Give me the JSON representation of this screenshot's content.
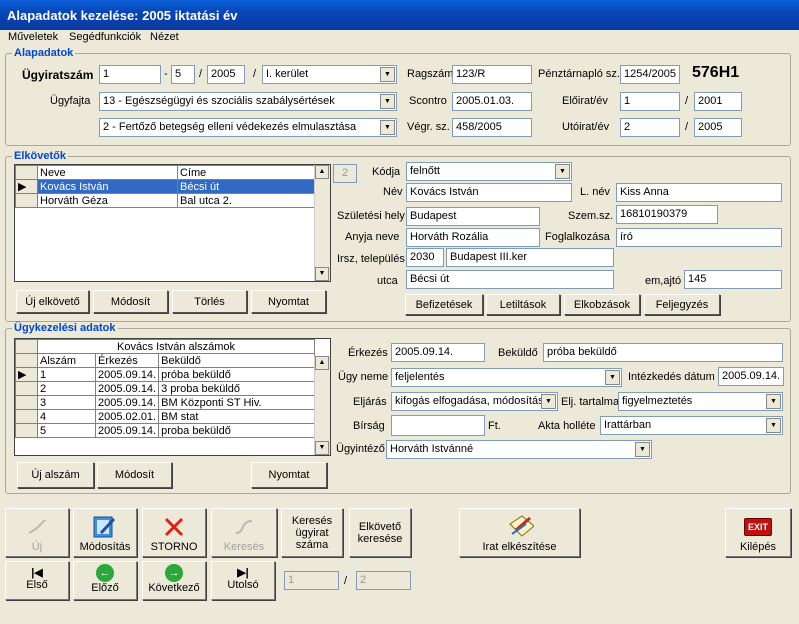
{
  "window": {
    "title": "Alapadatok kezelése:  2005 iktatási év"
  },
  "menu": [
    "Műveletek",
    "Segédfunkciók",
    "Nézet"
  ],
  "alap": {
    "group_title": "Alapadatok",
    "ugyiratszam_label": "Ügyiratszám",
    "ugyiratszam_1": "1",
    "ugyiratszam_dash": "-",
    "ugyiratszam_2": "5",
    "slash1": "/",
    "ugyiratszam_3": "2005",
    "slash2": "/",
    "kerulet": "I. kerület",
    "ragszam_label": "Ragszám",
    "ragszam": "123/R",
    "penztar_label": "Pénztárnapló sz.",
    "penztar": "1254/2005",
    "code": "576H1",
    "ugyfajta_label": "Ügyfajta",
    "ugyfajta1": "13 - Egészségügyi és szociális szabálysértések",
    "ugyfajta2": "2 - Fertőző betegség elleni védekezés elmulasztása",
    "scontro_label": "Scontro",
    "scontro": "2005.01.03.",
    "eloirat_label": "Előirat/év",
    "eloirat": "1",
    "eloirat_slash": "/",
    "eloirat_ev": "2001",
    "vegr_label": "Végr. sz.",
    "vegr": "458/2005",
    "utoirat_label": "Utóirat/év",
    "utoirat": "2",
    "utoirat_slash": "/",
    "utoirat_ev": "2005"
  },
  "elk": {
    "group_title": "Elkövetők",
    "columns": [
      "Neve",
      "Címe"
    ],
    "rows": [
      [
        "Kovács István",
        "Bécsi út"
      ],
      [
        "Horváth Géza",
        "Bal utca 2."
      ]
    ],
    "count": "2",
    "kodja_label": "Kódja",
    "kodja": "felnőtt",
    "nev_label": "Név",
    "nev": "Kovács István",
    "lnev_label": "L. név",
    "lnev": "Kiss Anna",
    "szulhely_label": "Születési hely",
    "szulhely": "Budapest",
    "szemsz_label": "Szem.sz.",
    "szemsz": "16810190379",
    "anyja_label": "Anyja neve",
    "anyja": "Horváth Rozália",
    "fogl_label": "Foglalkozása",
    "fogl": "író",
    "irsz_label": "Irsz, település",
    "irsz": "2030",
    "telepules": "Budapest III.ker",
    "utca_label": "utca",
    "utca": "Bécsi út",
    "emajto_label": "em,ajtó",
    "emajto": "145",
    "buttons": {
      "uj": "Új elkövető",
      "modosit": "Módosít",
      "torles": "Törlés",
      "nyomtat": "Nyomtat",
      "befiz": "Befizetések",
      "letilt": "Letiltások",
      "elkob": "Elkobzások",
      "feljegy": "Feljegyzés"
    }
  },
  "ugy": {
    "group_title": "Ügykezelési adatok",
    "grid_title": "Kovács István alszámok",
    "columns": [
      "Alszám",
      "Érkezés",
      "Beküldő"
    ],
    "rows": [
      [
        "1",
        "2005.09.14.",
        "próba beküldő"
      ],
      [
        "2",
        "2005.09.14.",
        "3 proba beküldő"
      ],
      [
        "3",
        "2005.09.14.",
        "BM Központi ST Hiv."
      ],
      [
        "4",
        "2005.02.01.",
        "BM stat"
      ],
      [
        "5",
        "2005.09.14.",
        "proba beküldő"
      ]
    ],
    "erkezes_label": "Érkezés",
    "erkezes": "2005.09.14.",
    "bekuldo_label": "Beküldő",
    "bekuldo": "próba beküldő",
    "ugyneme_label": "Ügy neme",
    "ugyneme": "feljelentés",
    "intezkedes_label": "Intézkedés dátum",
    "intezkedes": "2005.09.14.",
    "eljaras_label": "Eljárás",
    "eljaras": "kifogás elfogadása, módosítás",
    "eljtart_label": "Elj. tartalma",
    "eljtart": "figyelmeztetés",
    "birsag_label": "Bírság",
    "birsag": "",
    "ft": "Ft.",
    "akta_label": "Akta holléte",
    "akta": "Irattárban",
    "ugyintezo_label": "Ügyintéző",
    "ugyintezo": "Horváth Istvánné",
    "buttons": {
      "uj": "Új alszám",
      "modosit": "Módosít",
      "nyomtat": "Nyomtat"
    }
  },
  "toolbar": {
    "uj": "Új",
    "modositas": "Módosítás",
    "storno": "STORNO",
    "kereses": "Keresés",
    "kereses_ugy": "Keresés ügyirat száma",
    "elkoveto_ker": "Elkövető keresése",
    "irat": "Irat elkészítése",
    "kilepes": "Kilépés",
    "exit": "EXIT",
    "elso": "Első",
    "elozo": "Előző",
    "kovetkezo": "Következő",
    "utolso": "Utolsó",
    "page": "1",
    "page_slash": "/",
    "total": "2"
  }
}
